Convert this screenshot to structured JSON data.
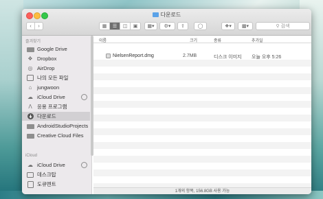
{
  "window": {
    "title": "다운로드"
  },
  "toolbar": {
    "back_icon": "chevron-left-icon",
    "forward_icon": "chevron-right-icon",
    "dropbox_icon": "dropbox-icon",
    "search_placeholder": "검색"
  },
  "sidebar": {
    "favorites_header": "즐겨찾기",
    "favorites": [
      {
        "label": "Google Drive",
        "icon": "folder-icon"
      },
      {
        "label": "Dropbox",
        "icon": "dropbox-icon"
      },
      {
        "label": "AirDrop",
        "icon": "airdrop-icon"
      },
      {
        "label": "나의 모든 파일",
        "icon": "all-files-icon"
      },
      {
        "label": "jungwoon",
        "icon": "home-icon"
      },
      {
        "label": "iCloud Drive",
        "icon": "cloud-icon"
      },
      {
        "label": "응용 프로그램",
        "icon": "applications-icon"
      },
      {
        "label": "다운로드",
        "icon": "downloads-icon",
        "selected": true
      },
      {
        "label": "AndroidStudioProjects",
        "icon": "folder-icon"
      },
      {
        "label": "Creative Cloud Files",
        "icon": "folder-icon"
      }
    ],
    "icloud_header": "iCloud",
    "icloud": [
      {
        "label": "iCloud Drive",
        "icon": "cloud-icon"
      },
      {
        "label": "데스크탑",
        "icon": "desktop-icon"
      },
      {
        "label": "도큐멘트",
        "icon": "documents-icon"
      }
    ]
  },
  "columns": {
    "name": "이름",
    "size": "크기",
    "kind": "종류",
    "added": "추가일"
  },
  "files": [
    {
      "name": "NielsenReport.dmg",
      "size": "2.7MB",
      "kind": "디스크 이미지",
      "added": "오늘 오후 5:26"
    }
  ],
  "status": {
    "text": "1개의 항목, 156.8GB 사용 가능"
  },
  "colors": {
    "sidebar_bg": "#ece9ec",
    "selected_bg": "#d2d0d3",
    "folder_blue": "#5aa2e8"
  }
}
